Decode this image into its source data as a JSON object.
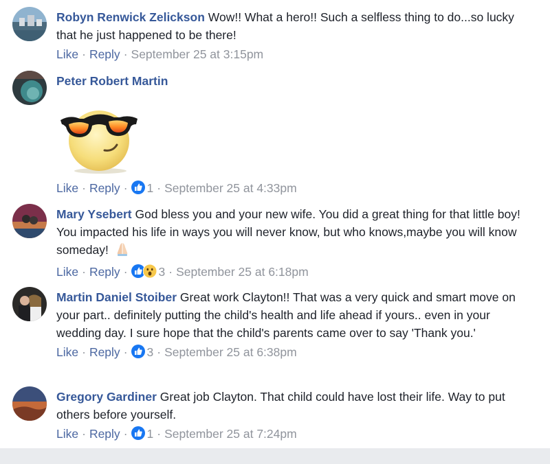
{
  "comments": [
    {
      "author": "Robyn Renwick Zelickson",
      "text": "Wow!! What a hero!! Such a selfless thing to do...so lucky that he just happened to be there!",
      "like_label": "Like",
      "reply_label": "Reply",
      "reaction_count": "",
      "timestamp": "September 25 at 3:15pm"
    },
    {
      "author": "Peter Robert Martin",
      "text": "",
      "sticker": "sunglasses-emoji",
      "like_label": "Like",
      "reply_label": "Reply",
      "reaction_count": "1",
      "timestamp": "September 25 at 4:33pm"
    },
    {
      "author": "Mary Ysebert",
      "text": "God bless you and your new wife. You did a great thing for that little boy! You impacted his life in ways you will never know, but who knows,maybe you will know someday!",
      "text_emoji": "praying-hands-icon",
      "like_label": "Like",
      "reply_label": "Reply",
      "reaction_count": "3",
      "timestamp": "September 25 at 6:18pm"
    },
    {
      "author": "Martin Daniel Stoiber",
      "text": "Great work Clayton!! That was a very quick and smart move on your part.. definitely putting the child's health and life ahead if yours.. even in your wedding day. I sure hope that the child's parents came over to say 'Thank you.'",
      "like_label": "Like",
      "reply_label": "Reply",
      "reaction_count": "3",
      "timestamp": "September 25 at 6:38pm"
    },
    {
      "author": "Gregory Gardiner",
      "text": "Great job Clayton. That child could have lost their life. Way to put others before yourself.",
      "like_label": "Like",
      "reply_label": "Reply",
      "reaction_count": "1",
      "timestamp": "September 25 at 7:24pm"
    }
  ],
  "colors": {
    "author": "#365899",
    "action_link": "#4b67a1",
    "meta": "#90949c",
    "like_blue": "#1877f2",
    "wow_yellow": "#f7c84b"
  },
  "separator": "·"
}
